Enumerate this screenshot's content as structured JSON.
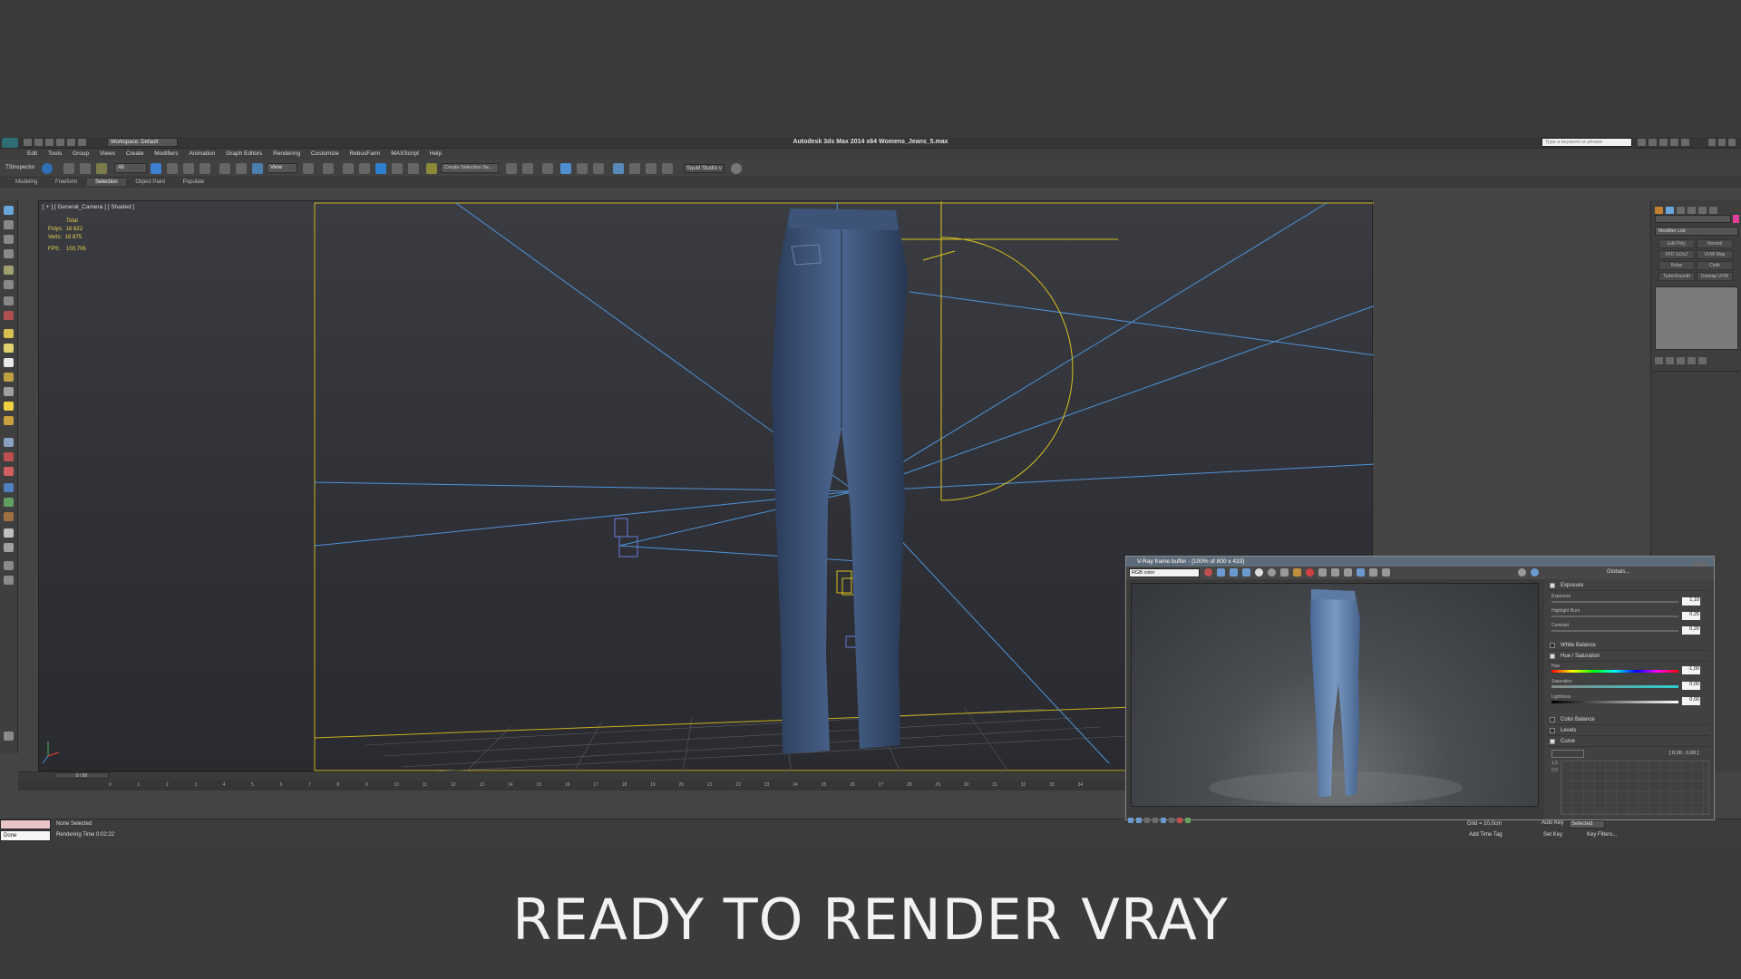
{
  "window": {
    "title": "Autodesk 3ds Max  2014 x64      Womens_Jeans_5.max",
    "workspace": "Workspace: Default",
    "search_placeholder": "Type a keyword or phrase"
  },
  "menu": [
    "Edit",
    "Tools",
    "Group",
    "Views",
    "Create",
    "Modifiers",
    "Animation",
    "Graph Editors",
    "Rendering",
    "Customize",
    "RebusFarm",
    "MAXScript",
    "Help"
  ],
  "toolbar": {
    "inspector": "TSInspector",
    "filter": "All",
    "view": "View",
    "selection_set": "Create Selection Se...",
    "studio": "Squid Studio v"
  },
  "ribbon_tabs": [
    "Modeling",
    "Freeform",
    "Selection",
    "Object Paint",
    "Populate"
  ],
  "viewport": {
    "label": "[ + ] [ General_Camera ] [ Shaded ]",
    "stats": {
      "total_label": "Total",
      "polys_label": "Polys:",
      "polys": "16 822",
      "verts_label": "Verts:",
      "verts": "16 875",
      "fps_label": "FPS:",
      "fps": "100,706"
    }
  },
  "modifier_panel": {
    "list_label": "Modifier List",
    "buttons": [
      "Edit Poly",
      "Normal",
      "FFD 2x2x2",
      "UVW Map",
      "Relax",
      "Cloth",
      "TurboSmooth",
      "Unwrap UVW"
    ]
  },
  "timeline": {
    "frame": "0 / 50",
    "ticks": [
      "0",
      "1",
      "2",
      "3",
      "4",
      "5",
      "6",
      "7",
      "8",
      "9",
      "10",
      "11",
      "12",
      "13",
      "14",
      "15",
      "16",
      "17",
      "18",
      "19",
      "20",
      "21",
      "22",
      "23",
      "24",
      "25",
      "26",
      "27",
      "28",
      "29",
      "30",
      "31",
      "32",
      "33",
      "34"
    ]
  },
  "status": {
    "done": "Done",
    "selection": "None Selected",
    "render_time": "Rendering Time  0:02:22",
    "grid": "Grid = 10,0cm",
    "add_time_tag": "Add Time Tag",
    "auto_key": "Auto Key",
    "selected": "Selected",
    "set_key": "Set Key",
    "key_filters": "Key Filters..."
  },
  "vfb": {
    "title": "V-Ray frame buffer - [100% of 800 x 433]",
    "channel": "RGB color",
    "globals": "Globals...",
    "exposure": {
      "label": "Exposure",
      "exp_label": "Exposure",
      "exp_value": "1,10",
      "hb_label": "Highlight Burn",
      "hb_value": "0,25",
      "contrast_label": "Contrast",
      "contrast_value": "0,20"
    },
    "white_balance": "White Balance",
    "hue_sat": {
      "label": "Hue / Saturation",
      "hue_label": "Hue",
      "hue_value": "-1,00",
      "sat_label": "Saturation",
      "sat_value": "0,00",
      "light_label": "Lightness",
      "light_value": "0,00"
    },
    "color_balance": "Color Balance",
    "levels": "Levels",
    "curve": "Curve",
    "curve_coords": "[ 0,00 ; 0,00 ]",
    "curve_tick_a": "1,0",
    "curve_tick_b": "0,9"
  },
  "caption": "READY TO RENDER  VRAY",
  "colors": {
    "accent_yellow": "#e8d44a",
    "wire_blue": "#4f93d6",
    "selection_yellow": "#d8c21e"
  }
}
